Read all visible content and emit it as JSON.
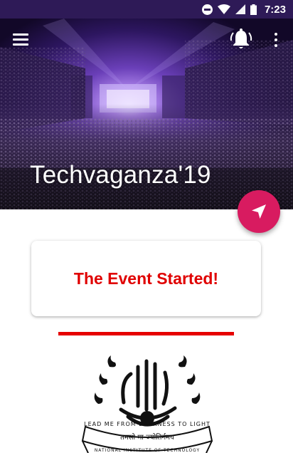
{
  "status_bar": {
    "time": "7:23",
    "icons": [
      "do-not-disturb-icon",
      "wifi-icon",
      "signal-icon",
      "battery-icon"
    ],
    "background": "#2e1a57"
  },
  "toolbar": {
    "menu_icon": "hamburger-menu-icon",
    "notification_icon": "bell-ringing-icon",
    "overflow_icon": "more-vert-icon"
  },
  "header": {
    "title": "Techvaganza'19",
    "image": "concert-crowd-stage-image"
  },
  "fab": {
    "icon": "navigation-arrow-icon",
    "color": "#d81b60"
  },
  "card": {
    "message": "The Event Started!",
    "message_color": "#e00000"
  },
  "divider": {
    "color": "#e60000"
  },
  "emblem": {
    "image": "institute-seal-logo",
    "motto_line1": "LEAD ME FROM DARKNESS TO LIGHT",
    "motto_line2": "NATIONAL INSTITUTE OF TECHNOLOGY",
    "hindi_text": "तमसो मा ज्योतिर्गमय"
  }
}
